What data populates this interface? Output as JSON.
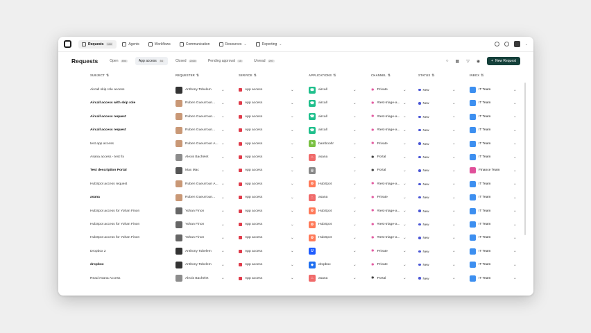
{
  "nav": {
    "items": [
      {
        "label": "Requests",
        "badge": "000",
        "active": true
      },
      {
        "label": "Agents"
      },
      {
        "label": "Workflows"
      },
      {
        "label": "Communication"
      },
      {
        "label": "Resources",
        "dropdown": true
      },
      {
        "label": "Reporting",
        "dropdown": true
      }
    ]
  },
  "header": {
    "title": "Requests",
    "filters": [
      {
        "label": "Open",
        "count": "494"
      },
      {
        "label": "App access",
        "count": "54",
        "active": true
      },
      {
        "label": "Closed",
        "count": "2030"
      },
      {
        "label": "Pending approval",
        "count": "15"
      },
      {
        "label": "Unread",
        "count": "297"
      }
    ],
    "new_request_label": "New Request"
  },
  "columns": [
    "SUBJECT",
    "REQUESTER",
    "SERVICE",
    "APPLICATIONS",
    "CHANNEL",
    "STATUS",
    "INBOX"
  ],
  "rows": [
    {
      "subject": "Aircall skip role access",
      "bold": false,
      "requester": "Anthony Tobelem",
      "av": "#333",
      "service": "App access",
      "app": "aircall",
      "appColor": "#1fbf8c",
      "appGlyph": "☎",
      "channel": "Private",
      "chanColor": "#e0509a",
      "status": "New",
      "inbox": "IT Team",
      "inColor": "#3d8ff0"
    },
    {
      "subject": "Aircall access with skip role",
      "bold": true,
      "requester": "Ruben Gueurroun...",
      "av": "#c99876",
      "service": "App access",
      "app": "aircall",
      "appColor": "#1fbf8c",
      "appGlyph": "☎",
      "channel": "#test-triage-a...",
      "chanColor": "#e0509a",
      "status": "New",
      "inbox": "IT Team",
      "inColor": "#3d8ff0"
    },
    {
      "subject": "Aircall access request",
      "bold": true,
      "requester": "Ruben Gueurroun...",
      "av": "#c99876",
      "service": "App access",
      "app": "aircall",
      "appColor": "#1fbf8c",
      "appGlyph": "☎",
      "channel": "#test-triage-a...",
      "chanColor": "#e0509a",
      "status": "New",
      "inbox": "IT Team",
      "inColor": "#3d8ff0"
    },
    {
      "subject": "Aircall access request",
      "bold": true,
      "requester": "Ruben Gueurroun...",
      "av": "#c99876",
      "service": "App access",
      "app": "aircall",
      "appColor": "#1fbf8c",
      "appGlyph": "☎",
      "channel": "#test-triage-a...",
      "chanColor": "#e0509a",
      "status": "New",
      "inbox": "IT Team",
      "inColor": "#3d8ff0"
    },
    {
      "subject": "test app access",
      "bold": false,
      "requester": "Ruben Gueurroun A...",
      "av": "#c99876",
      "service": "App access",
      "app": "bamboohr",
      "appColor": "#7ac143",
      "appGlyph": "b",
      "channel": "Private",
      "chanColor": "#e0509a",
      "status": "New",
      "inbox": "IT Team",
      "inColor": "#3d8ff0"
    },
    {
      "subject": "Asana access - test fix",
      "bold": false,
      "requester": "Alexis Bachelet",
      "av": "#8c8c8c",
      "service": "App access",
      "app": "asana",
      "appColor": "#f06a6a",
      "appGlyph": "∴",
      "channel": "Portal",
      "chanColor": "#333",
      "status": "New",
      "inbox": "IT Team",
      "inColor": "#3d8ff0"
    },
    {
      "subject": "Test description Portal",
      "bold": true,
      "requester": "Max Mac",
      "av": "#555",
      "service": "App access",
      "app": "",
      "appColor": "#888",
      "appGlyph": "◎",
      "channel": "Portal",
      "chanColor": "#333",
      "status": "New",
      "inbox": "Finance Team",
      "inColor": "#e0509a"
    },
    {
      "subject": "HubSpot access request",
      "bold": false,
      "requester": "Ruben Gueurroun A...",
      "av": "#c99876",
      "service": "App access",
      "app": "HubSpot",
      "appColor": "#ff7a59",
      "appGlyph": "⚙",
      "channel": "#test-triage-a...",
      "chanColor": "#e0509a",
      "status": "New",
      "inbox": "IT Team",
      "inColor": "#3d8ff0"
    },
    {
      "subject": "asana",
      "bold": true,
      "requester": "Ruben Gueurroun...",
      "av": "#c99876",
      "service": "App access",
      "app": "asana",
      "appColor": "#f06a6a",
      "appGlyph": "∴",
      "channel": "Private",
      "chanColor": "#e0509a",
      "status": "New",
      "inbox": "IT Team",
      "inColor": "#3d8ff0"
    },
    {
      "subject": "HubSpot access for Yohan Finon",
      "bold": false,
      "requester": "Yohan Finon",
      "av": "#666",
      "service": "App access",
      "app": "HubSpot",
      "appColor": "#ff7a59",
      "appGlyph": "⚙",
      "channel": "#test-triage-a...",
      "chanColor": "#e0509a",
      "status": "New",
      "inbox": "IT Team",
      "inColor": "#3d8ff0"
    },
    {
      "subject": "HubSpot access for Yohan Finon",
      "bold": false,
      "requester": "Yohan Finon",
      "av": "#666",
      "service": "App access",
      "app": "HubSpot",
      "appColor": "#ff7a59",
      "appGlyph": "⚙",
      "channel": "#test-triage-a...",
      "chanColor": "#e0509a",
      "status": "New",
      "inbox": "IT Team",
      "inColor": "#3d8ff0"
    },
    {
      "subject": "HubSpot access for Yohan Finon",
      "bold": false,
      "requester": "Yohan Finon",
      "av": "#666",
      "service": "App access",
      "app": "HubSpot",
      "appColor": "#ff7a59",
      "appGlyph": "⚙",
      "channel": "#test-triage-a...",
      "chanColor": "#e0509a",
      "status": "New",
      "inbox": "IT Team",
      "inColor": "#3d8ff0"
    },
    {
      "subject": "Dropbox 2",
      "bold": false,
      "requester": "Anthony Tobelem",
      "av": "#333",
      "service": "App access",
      "app": "",
      "appColor": "#1f5cff",
      "appGlyph": "U",
      "channel": "Private",
      "chanColor": "#e0509a",
      "status": "New",
      "inbox": "IT Team",
      "inColor": "#3d8ff0"
    },
    {
      "subject": "dropbox",
      "bold": true,
      "requester": "Anthony Tobelem",
      "av": "#333",
      "service": "App access",
      "app": "dropbox",
      "appColor": "#1f6ff0",
      "appGlyph": "◆",
      "channel": "Private",
      "chanColor": "#e0509a",
      "status": "New",
      "inbox": "IT Team",
      "inColor": "#3d8ff0"
    },
    {
      "subject": "Read Asana Access",
      "bold": false,
      "requester": "Alexis Bachelet",
      "av": "#8c8c8c",
      "service": "App access",
      "app": "asana",
      "appColor": "#f06a6a",
      "appGlyph": "∴",
      "channel": "Portal",
      "chanColor": "#333",
      "status": "New",
      "inbox": "IT Team",
      "inColor": "#3d8ff0"
    }
  ]
}
